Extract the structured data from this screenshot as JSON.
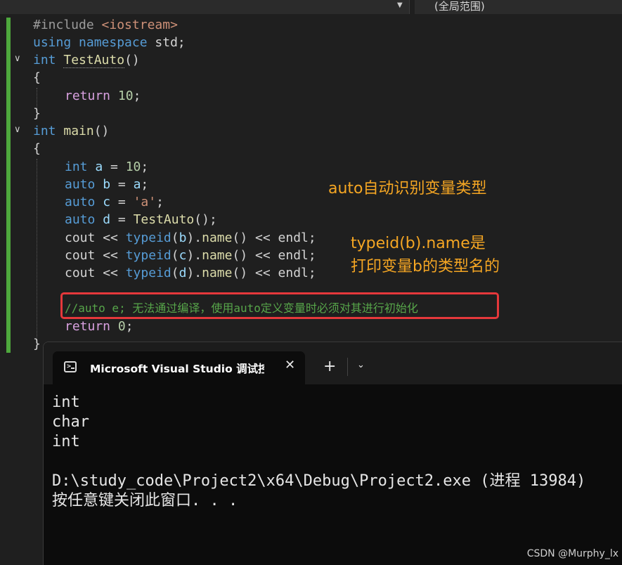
{
  "toolbar": {
    "scope_dropdown": "(全局范围)"
  },
  "code": {
    "l1": {
      "pre": "#include ",
      "str": "<iostream>"
    },
    "l2": {
      "kw1": "using",
      "sp": " ",
      "kw2": "namespace",
      "rest": " std;"
    },
    "l3": {
      "kw": "int",
      "sp": " ",
      "fn": "TestAuto",
      "rest": "()"
    },
    "l4": {
      "text": "{"
    },
    "l5": {
      "ctl": "return",
      "sp": " ",
      "num": "10",
      "rest": ";"
    },
    "l6": {
      "text": "}"
    },
    "l7": {
      "kw": "int",
      "sp": " ",
      "fn": "main",
      "rest": "()"
    },
    "l8": {
      "text": "{"
    },
    "l9": {
      "kw": "int",
      "sp": " ",
      "var": "a",
      "eq": " = ",
      "num": "10",
      "rest": ";"
    },
    "l10": {
      "kw": "auto",
      "sp": " ",
      "var": "b",
      "eq": " = ",
      "var2": "a",
      "rest": ";"
    },
    "l11": {
      "kw": "auto",
      "sp": " ",
      "var": "c",
      "eq": " = ",
      "str": "'a'",
      "rest": ";"
    },
    "l12": {
      "kw": "auto",
      "sp": " ",
      "var": "d",
      "eq": " = ",
      "fn": "TestAuto",
      "rest": "();"
    },
    "l13": {
      "v1": "cout",
      "op": " << ",
      "kw": "typeid",
      "p1": "(",
      "var": "b",
      "p2": ").",
      "fn": "name",
      "p3": "()",
      "op2": " << ",
      "v2": "endl",
      "rest": ";"
    },
    "l14": {
      "v1": "cout",
      "op": " << ",
      "kw": "typeid",
      "p1": "(",
      "var": "c",
      "p2": ").",
      "fn": "name",
      "p3": "()",
      "op2": " << ",
      "v2": "endl",
      "rest": ";"
    },
    "l15": {
      "v1": "cout",
      "op": " << ",
      "kw": "typeid",
      "p1": "(",
      "var": "d",
      "p2": ").",
      "fn": "name",
      "p3": "()",
      "op2": " << ",
      "v2": "endl",
      "rest": ";"
    },
    "l16": {
      "cmt": "//auto e; 无法通过编译，使用auto定义变量时必须对其进行初始化"
    },
    "l17": {
      "ctl": "return",
      "sp": " ",
      "num": "0",
      "rest": ";"
    },
    "l18": {
      "text": "}"
    }
  },
  "annotations": {
    "auto_note": "auto自动识别变量类型",
    "typeid_note_line1": "typeid(b).name是",
    "typeid_note_line2": "打印变量b的类型名的"
  },
  "terminal": {
    "title": "Microsoft Visual Studio 调试控制台",
    "close_glyph": "✕",
    "new_tab_glyph": "+",
    "dropdown_glyph": "⌄",
    "output": {
      "line1": "int",
      "line2": "char",
      "line3": "int",
      "line4": "",
      "line5": "D:\\study_code\\Project2\\x64\\Debug\\Project2.exe (进程 13984)",
      "line6": "按任意键关闭此窗口. . ."
    }
  },
  "watermark": "CSDN @Murphy_lx"
}
